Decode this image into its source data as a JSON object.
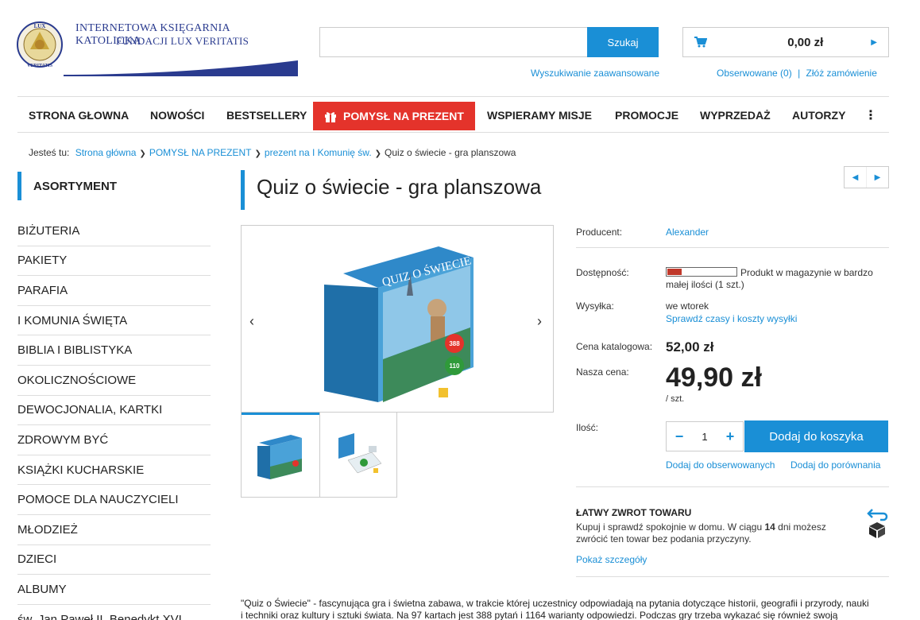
{
  "logo": {
    "line1": "INTERNETOWA KSIĘGARNIA KATOLICKA",
    "line2": "FUNDACJI LUX VERITATIS",
    "seal_top": "LUX",
    "seal_bottom": "VERITATIS"
  },
  "search": {
    "placeholder": "",
    "button": "Szukaj",
    "advanced": "Wyszukiwanie zaawansowane"
  },
  "cart": {
    "total": "0,00 zł",
    "icon": "cart-icon"
  },
  "user": {
    "watched": "Obserwowane (0)",
    "separator": "|",
    "order": "Złóż zamówienie"
  },
  "nav": {
    "items": [
      "STRONA GŁOWNA",
      "NOWOŚCI",
      "BESTSELLERY",
      "POMYSŁ NA PREZENT",
      "WSPIERAMY MISJE",
      "PROMOCJE",
      "WYPRZEDAŻ",
      "AUTORZY"
    ],
    "more": "⋮"
  },
  "breadcrumb": {
    "prefix": "Jesteś tu:",
    "items": [
      "Strona główna",
      "POMYSŁ NA PREZENT",
      "prezent na I Komunię św.",
      "Quiz o świecie - gra planszowa"
    ]
  },
  "sidebar": {
    "heading": "ASORTYMENT",
    "items": [
      "BIŻUTERIA",
      "PAKIETY",
      "PARAFIA",
      "I KOMUNIA ŚWIĘTA",
      "BIBLIA I BIBLISTYKA",
      "OKOLICZNOŚCIOWE",
      "DEWOCJONALIA, KARTKI",
      "ZDROWYM BYĆ",
      "KSIĄŻKI KUCHARSKIE",
      "POMOCE DLA NAUCZYCIELI",
      "MŁODZIEŻ",
      "DZIECI",
      "ALBUMY",
      "św. Jan Paweł II, Benedykt XVI"
    ]
  },
  "product": {
    "title": "Quiz o świecie - gra planszowa",
    "box_title": "QUIZ O ŚWIECIE",
    "box_badge_1": "388",
    "box_badge_2": "110",
    "producer_label": "Producent:",
    "producer": "Alexander",
    "availability_label": "Dostępność:",
    "availability_level": 0.2,
    "availability_text_1": "Produkt w magazynie w bardzo",
    "availability_text_2": "małej ilości (1 szt.)",
    "shipping_label": "Wysyłka:",
    "shipping": "we wtorek",
    "shipping_link": "Sprawdź czasy i koszty wysyłki",
    "catalog_price_label": "Cena katalogowa:",
    "catalog_price": "52,00 zł",
    "our_price_label": "Nasza cena:",
    "our_price": "49,90 zł",
    "unit": "/ szt.",
    "qty_label": "Ilość:",
    "qty": "1",
    "add_to_cart": "Dodaj do koszyka",
    "add_watch": "Dodaj do obserwowanych",
    "add_compare": "Dodaj do porównania",
    "return_title": "ŁATWY ZWROT TOWARU",
    "return_text_pre": "Kupuj i sprawdź spokojnie w domu. W ciągu ",
    "return_days": "14",
    "return_text_post": " dni możesz",
    "return_text_2": "zwrócić ten towar bez podania przyczyny.",
    "return_link": "Pokaż szczegóły",
    "description_1": "\"Quiz o Świecie\" - fascynująca gra i świetna zabawa, w trakcie której uczestnicy odpowiadają na pytania dotyczące historii, geografii i przyrody, nauki",
    "description_2": "i techniki oraz kultury i sztuki świata. Na 97 kartach jest 388 pytań i 1164 warianty odpowiedzi. Podczas gry trzeba wykazać się również swoją"
  },
  "colors": {
    "accent": "#1a8fd6",
    "gift": "#e4332b",
    "stock": "#c0392b"
  }
}
